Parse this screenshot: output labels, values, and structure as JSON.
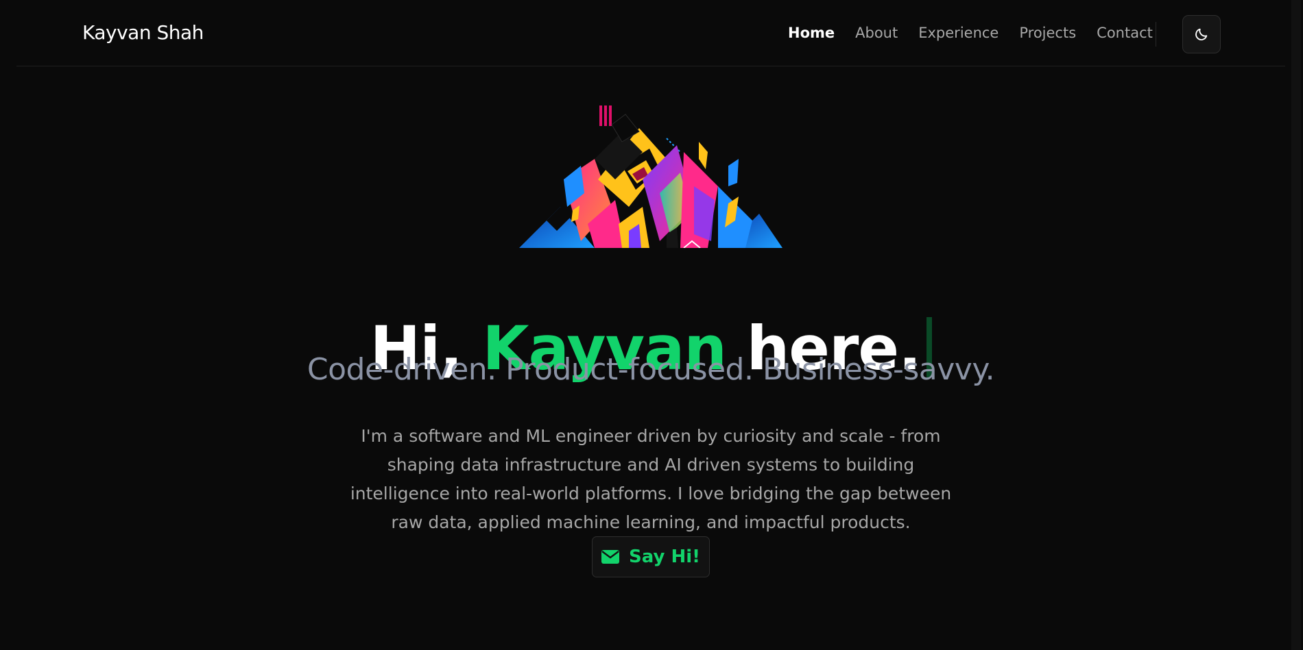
{
  "brand": {
    "name": "Kayvan Shah"
  },
  "nav": {
    "items": [
      {
        "label": "Home",
        "active": true
      },
      {
        "label": "About",
        "active": false
      },
      {
        "label": "Experience",
        "active": false
      },
      {
        "label": "Projects",
        "active": false
      },
      {
        "label": "Contact",
        "active": false
      }
    ],
    "theme_toggle_icon": "moon-icon"
  },
  "hero": {
    "greeting_prefix": "Hi, ",
    "name": "Kayvan",
    "greeting_suffix": " here.",
    "subtitle": "Code-driven. Product-focused. Business-savvy.",
    "bio": "I'm a software and ML engineer driven by curiosity and scale - from shaping data infrastructure and AI driven systems to building intelligence into real-world platforms. I love bridging the gap between raw data, applied machine learning, and impactful products.",
    "cta_label": "Say Hi!",
    "cta_icon": "envelope-icon"
  },
  "colors": {
    "background": "#0a0a0a",
    "accent": "#12d36b",
    "subtitle": "#8b93a5",
    "body_text": "#a7a7a7"
  }
}
